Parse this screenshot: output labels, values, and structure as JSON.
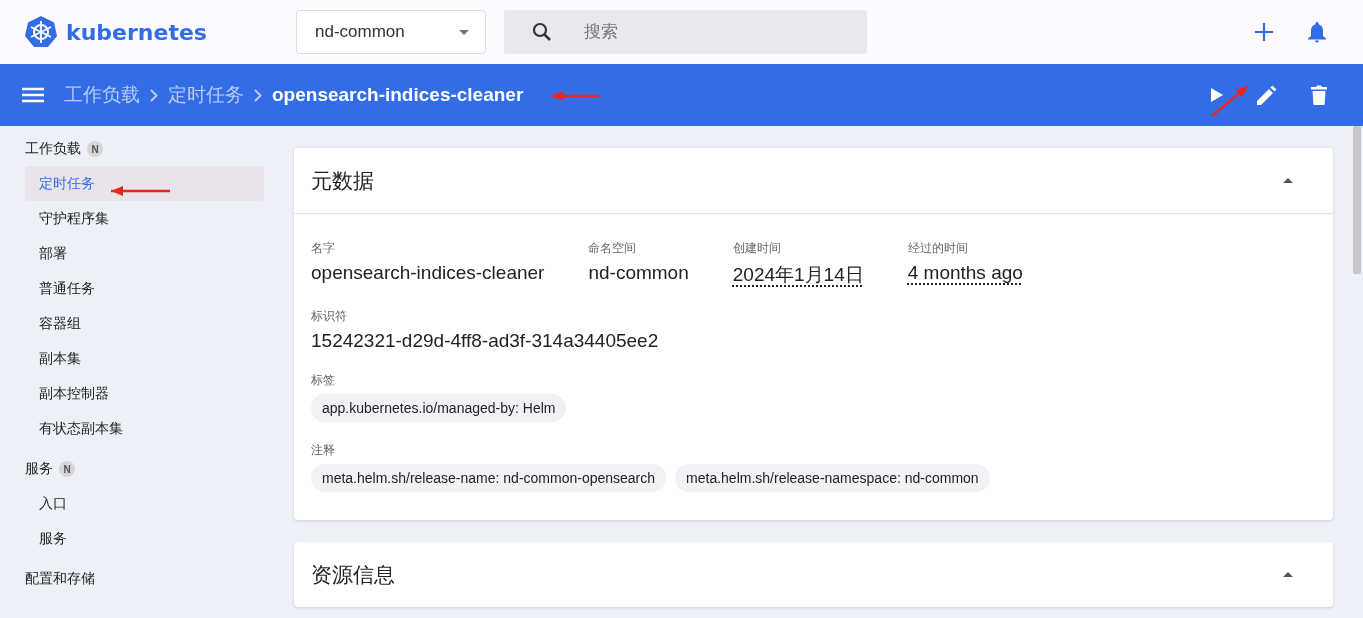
{
  "header": {
    "logo_text": "kubernetes",
    "namespace": {
      "value": "nd-common"
    },
    "search": {
      "placeholder": "搜索"
    }
  },
  "toolbar": {
    "breadcrumbs": [
      {
        "label": "工作负载",
        "current": false
      },
      {
        "label": "定时任务",
        "current": false
      },
      {
        "label": "opensearch-indices-cleaner",
        "current": true
      }
    ]
  },
  "sidebar": {
    "groups": [
      {
        "title": "工作负载",
        "badge": "N",
        "items": [
          {
            "label": "定时任务",
            "selected": true
          },
          {
            "label": "守护程序集",
            "selected": false
          },
          {
            "label": "部署",
            "selected": false
          },
          {
            "label": "普通任务",
            "selected": false
          },
          {
            "label": "容器组",
            "selected": false
          },
          {
            "label": "副本集",
            "selected": false
          },
          {
            "label": "副本控制器",
            "selected": false
          },
          {
            "label": "有状态副本集",
            "selected": false
          }
        ]
      },
      {
        "title": "服务",
        "badge": "N",
        "items": [
          {
            "label": "入口",
            "selected": false
          },
          {
            "label": "服务",
            "selected": false
          }
        ]
      },
      {
        "title": "配置和存储"
      }
    ]
  },
  "metadata_card": {
    "title": "元数据",
    "fields": [
      {
        "label": "名字",
        "value": "opensearch-indices-cleaner",
        "kind": "plain"
      },
      {
        "label": "命名空间",
        "value": "nd-common",
        "kind": "plain"
      },
      {
        "label": "创建时间",
        "value": "2024年1月14日",
        "kind": "dotted"
      },
      {
        "label": "经过的时间",
        "value": "4 months ago",
        "kind": "dotted"
      }
    ],
    "uid": {
      "label": "标识符",
      "value": "15242321-d29d-4ff8-ad3f-314a34405ee2"
    },
    "labels": {
      "label": "标签",
      "chips": [
        "app.kubernetes.io/managed-by: Helm"
      ]
    },
    "annotations": {
      "label": "注释",
      "chips": [
        "meta.helm.sh/release-name: nd-common-opensearch",
        "meta.helm.sh/release-namespace: nd-common"
      ]
    }
  },
  "resource_card": {
    "title": "资源信息"
  }
}
